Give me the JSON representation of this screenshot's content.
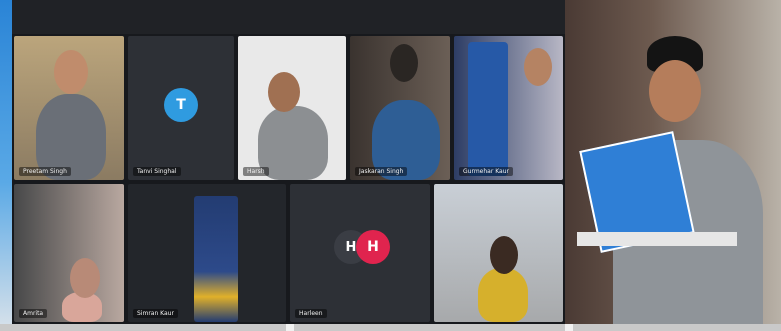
{
  "app": {
    "accent": "#2a84d6"
  },
  "tiles": [
    {
      "id": "t1",
      "num": "",
      "name": "Preetam Singh",
      "kind": "video"
    },
    {
      "id": "t2",
      "num": "",
      "name": "Tanvi Singhal",
      "kind": "avatar",
      "initial": "T",
      "color": "#2f9be0"
    },
    {
      "id": "t3",
      "num": "",
      "name": "Harsh",
      "kind": "video"
    },
    {
      "id": "t4",
      "num": "",
      "name": "Jaskaran Singh",
      "kind": "video"
    },
    {
      "id": "t5",
      "num": "",
      "name": "Gurmehar Kaur",
      "kind": "video"
    },
    {
      "id": "t6",
      "num": "",
      "name": "Amrita",
      "kind": "video"
    },
    {
      "id": "t7",
      "num": "",
      "name": "Simran Kaur",
      "kind": "video"
    },
    {
      "id": "t8",
      "num": "",
      "name": "Harleen",
      "kind": "avatar",
      "initial": "H",
      "color": "#e0244e"
    },
    {
      "id": "t9",
      "num": "",
      "name": "",
      "kind": "video"
    }
  ],
  "main": {
    "name": ""
  }
}
